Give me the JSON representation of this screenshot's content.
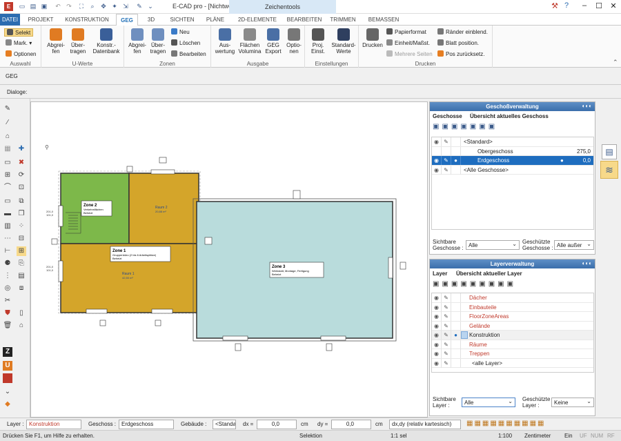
{
  "window": {
    "title": "E-CAD pro - [Nichtwo...",
    "contextual_tab": "Zeichentools",
    "minimize": "–",
    "maximize": "☐",
    "close": "✕"
  },
  "tabs": [
    "DATEI",
    "PROJEKT",
    "KONSTRUKTION",
    "GEG",
    "3D",
    "SICHTEN",
    "PLÄNE",
    "2D-ELEMENTE",
    "BEARBEITEN",
    "TRIMMEN",
    "BEMASSEN"
  ],
  "file_tab": "",
  "ribbon": {
    "auswahl": {
      "label": "Auswahl",
      "selekt": "Selekt",
      "mark": "Mark. ▾",
      "optionen": "Optionen"
    },
    "uwerte": {
      "label": "U-Werte",
      "abgreifen": "Abgrei-\nfen",
      "uebertragen": "Über-\ntragen",
      "konstr": "Konstr.-\nDatenbank"
    },
    "zonen": {
      "label": "Zonen",
      "abgreifen": "Abgrei-\nfen",
      "uebertragen": "Über-\ntragen",
      "neu": "Neu",
      "loeschen": "Löschen",
      "bearbeiten": "Bearbeiten"
    },
    "ausgabe": {
      "label": "Ausgabe",
      "auswertung": "Aus-\nwertung",
      "flaechen": "Flächen\nVolumina",
      "geg_export": "GEG\nExport",
      "optionen": "Optio-\nnen"
    },
    "einstellungen": {
      "label": "Einstellungen",
      "proj": "Proj.\nEinst.",
      "standard": "Standard-\nWerte"
    },
    "drucken": {
      "label": "Drucken",
      "drucken": "Drucken",
      "papierformat": "Papierformat",
      "einheit": "Einheit/Maßst.",
      "mehrere": "Mehrere Seiten",
      "raender": "Ränder einblend.",
      "blatt": "Blatt position.",
      "pos": "Pos zurücksetz."
    }
  },
  "subbar": {
    "geg": "GEG",
    "dialoge": "Dialoge:"
  },
  "drawing": {
    "zone2": {
      "title": "Zone 2",
      "line1": "Verkehrsflächen",
      "line2": "Beheizt"
    },
    "zone1": {
      "title": "Zone 1",
      "line1": "Gruppenbüro (2 bis 6 Arbeitsplätze)",
      "line2": "Beheizt"
    },
    "zone3": {
      "title": "Zone 3",
      "line1": "Werkstatt, Montage, Fertigung",
      "line2": "Beheizt"
    },
    "raum2": {
      "title": "Raum 2",
      "area": "20,88 m²"
    },
    "raum1": {
      "title": "Raum 1",
      "area": "42,50 m²"
    }
  },
  "geschoss_panel": {
    "title": "Geschoßverwaltung",
    "tab1": "Geschosse",
    "tab2": "Übersicht aktuelles Geschoss",
    "rows": [
      {
        "name": "<Standard>",
        "value": ""
      },
      {
        "name": "Obergeschoss",
        "value": "275,0"
      },
      {
        "name": "Erdgeschoss",
        "value": "0,0"
      },
      {
        "name": "<Alle Geschosse>",
        "value": ""
      }
    ],
    "sichtbare_label": "Sichtbare\nGeschosse :",
    "sichtbare_value": "Alle",
    "geschuetzte_label": "Geschützte\nGeschosse :",
    "geschuetzte_value": "Alle außer Aktive"
  },
  "layer_panel": {
    "title": "Layerverwaltung",
    "tab1": "Layer",
    "tab2": "Übersicht aktueller Layer",
    "rows": [
      "Dächer",
      "Einbauteile",
      "FloorZoneAreas",
      "Gelände",
      "Konstruktion",
      "Räume",
      "Treppen",
      "<alle Layer>"
    ],
    "sichtbare_label": "Sichtbare\nLayer :",
    "sichtbare_value": "Alle",
    "geschuetzte_label": "Geschützte\nLayer :",
    "geschuetzte_value": "Keine"
  },
  "statusbar": {
    "layer_label": "Layer :",
    "layer_value": "Konstruktion",
    "geschoss_label": "Geschoss :",
    "geschoss_value": "Erdgeschoss",
    "gebaeude_label": "Gebäude :",
    "gebaeude_value": "<Standa",
    "dx_label": "dx =",
    "dx_value": "0,0",
    "dy_label": "dy =",
    "dy_value": "0,0",
    "unit": "cm",
    "mode": "dx,dy (relativ kartesisch)",
    "help": "Drücken Sie F1, um Hilfe zu erhalten.",
    "selektion": "Selektion",
    "sel": "1:1 sel",
    "scale": "1:100",
    "units": "Zentimeter",
    "ein": "Ein",
    "uf": "UF",
    "num": "NUM",
    "rf": "RF"
  },
  "colors": {
    "zone_green": "#7db84a",
    "zone_gold": "#d4a52a",
    "zone_blue": "#b9dcdc",
    "accent": "#1e6dbf"
  }
}
